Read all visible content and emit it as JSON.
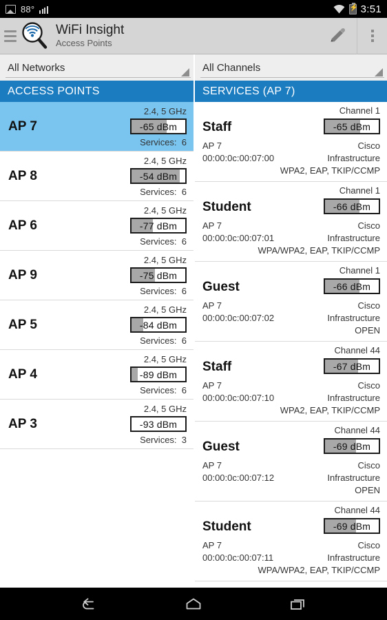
{
  "status_bar": {
    "temperature": "88°",
    "time": "3:51",
    "icons": [
      "photo-icon",
      "signal-bars-icon",
      "wifi-icon",
      "battery-charging-icon"
    ]
  },
  "action_bar": {
    "title": "WiFi Insight",
    "subtitle": "Access Points",
    "menu_icon": "hamburger-icon",
    "app_icon": "wifi-magnifier-icon",
    "edit_icon": "pencil-icon",
    "overflow_icon": "overflow-menu-icon"
  },
  "filters": {
    "network_filter": {
      "value": "All Networks"
    },
    "channel_filter": {
      "value": "All Channels"
    }
  },
  "access_points_panel": {
    "header": "ACCESS POINTS",
    "services_label": "Services:",
    "dbm_unit": "dBm",
    "rows": [
      {
        "name": "AP 7",
        "bands": "2.4, 5 GHz",
        "dbm": "-65",
        "dbm_text": "-65 dBm",
        "fill_pct": 66,
        "services": "6",
        "selected": true
      },
      {
        "name": "AP 8",
        "bands": "2.4, 5 GHz",
        "dbm": "-54",
        "dbm_text": "-54 dBm",
        "fill_pct": 90,
        "services": "6",
        "selected": false
      },
      {
        "name": "AP 6",
        "bands": "2.4, 5 GHz",
        "dbm": "-77",
        "dbm_text": "-77 dBm",
        "fill_pct": 40,
        "services": "6",
        "selected": false
      },
      {
        "name": "AP 9",
        "bands": "2.4, 5 GHz",
        "dbm": "-75",
        "dbm_text": "-75 dBm",
        "fill_pct": 44,
        "services": "6",
        "selected": false
      },
      {
        "name": "AP 5",
        "bands": "2.4, 5 GHz",
        "dbm": "-84",
        "dbm_text": "-84 dBm",
        "fill_pct": 22,
        "services": "6",
        "selected": false
      },
      {
        "name": "AP 4",
        "bands": "2.4, 5 GHz",
        "dbm": "-89",
        "dbm_text": "-89 dBm",
        "fill_pct": 12,
        "services": "6",
        "selected": false
      },
      {
        "name": "AP 3",
        "bands": "2.4, 5 GHz",
        "dbm": "-93",
        "dbm_text": "-93 dBm",
        "fill_pct": 0,
        "services": "3",
        "selected": false
      }
    ]
  },
  "services_panel": {
    "header": "SERVICES (AP 7)",
    "rows": [
      {
        "ssid": "Staff",
        "channel": "Channel 1",
        "dbm_text": "-65 dBm",
        "fill_pct": 66,
        "ap": "AP 7",
        "bssid": "00:00:0c:00:07:00",
        "vendor": "Cisco",
        "mode": "Infrastructure",
        "security": "WPA2, EAP, TKIP/CCMP"
      },
      {
        "ssid": "Student",
        "channel": "Channel 1",
        "dbm_text": "-66 dBm",
        "fill_pct": 64,
        "ap": "AP 7",
        "bssid": "00:00:0c:00:07:01",
        "vendor": "Cisco",
        "mode": "Infrastructure",
        "security": "WPA/WPA2, EAP, TKIP/CCMP"
      },
      {
        "ssid": "Guest",
        "channel": "Channel 1",
        "dbm_text": "-66 dBm",
        "fill_pct": 64,
        "ap": "AP 7",
        "bssid": "00:00:0c:00:07:02",
        "vendor": "Cisco",
        "mode": "Infrastructure",
        "security": "OPEN"
      },
      {
        "ssid": "Staff",
        "channel": "Channel 44",
        "dbm_text": "-67 dBm",
        "fill_pct": 62,
        "ap": "AP 7",
        "bssid": "00:00:0c:00:07:10",
        "vendor": "Cisco",
        "mode": "Infrastructure",
        "security": "WPA2, EAP, TKIP/CCMP"
      },
      {
        "ssid": "Guest",
        "channel": "Channel 44",
        "dbm_text": "-69 dBm",
        "fill_pct": 58,
        "ap": "AP 7",
        "bssid": "00:00:0c:00:07:12",
        "vendor": "Cisco",
        "mode": "Infrastructure",
        "security": "OPEN"
      },
      {
        "ssid": "Student",
        "channel": "Channel 44",
        "dbm_text": "-69 dBm",
        "fill_pct": 58,
        "ap": "AP 7",
        "bssid": "00:00:0c:00:07:11",
        "vendor": "Cisco",
        "mode": "Infrastructure",
        "security": "WPA/WPA2, EAP, TKIP/CCMP"
      }
    ]
  },
  "nav_bar": {
    "back": "back-icon",
    "home": "home-icon",
    "recents": "recents-icon"
  },
  "colors": {
    "header_blue": "#1C7CC0",
    "selected_row": "#79C5F0",
    "action_bar": "#D5D5D5",
    "meter_fill": "#A8A8A8"
  }
}
